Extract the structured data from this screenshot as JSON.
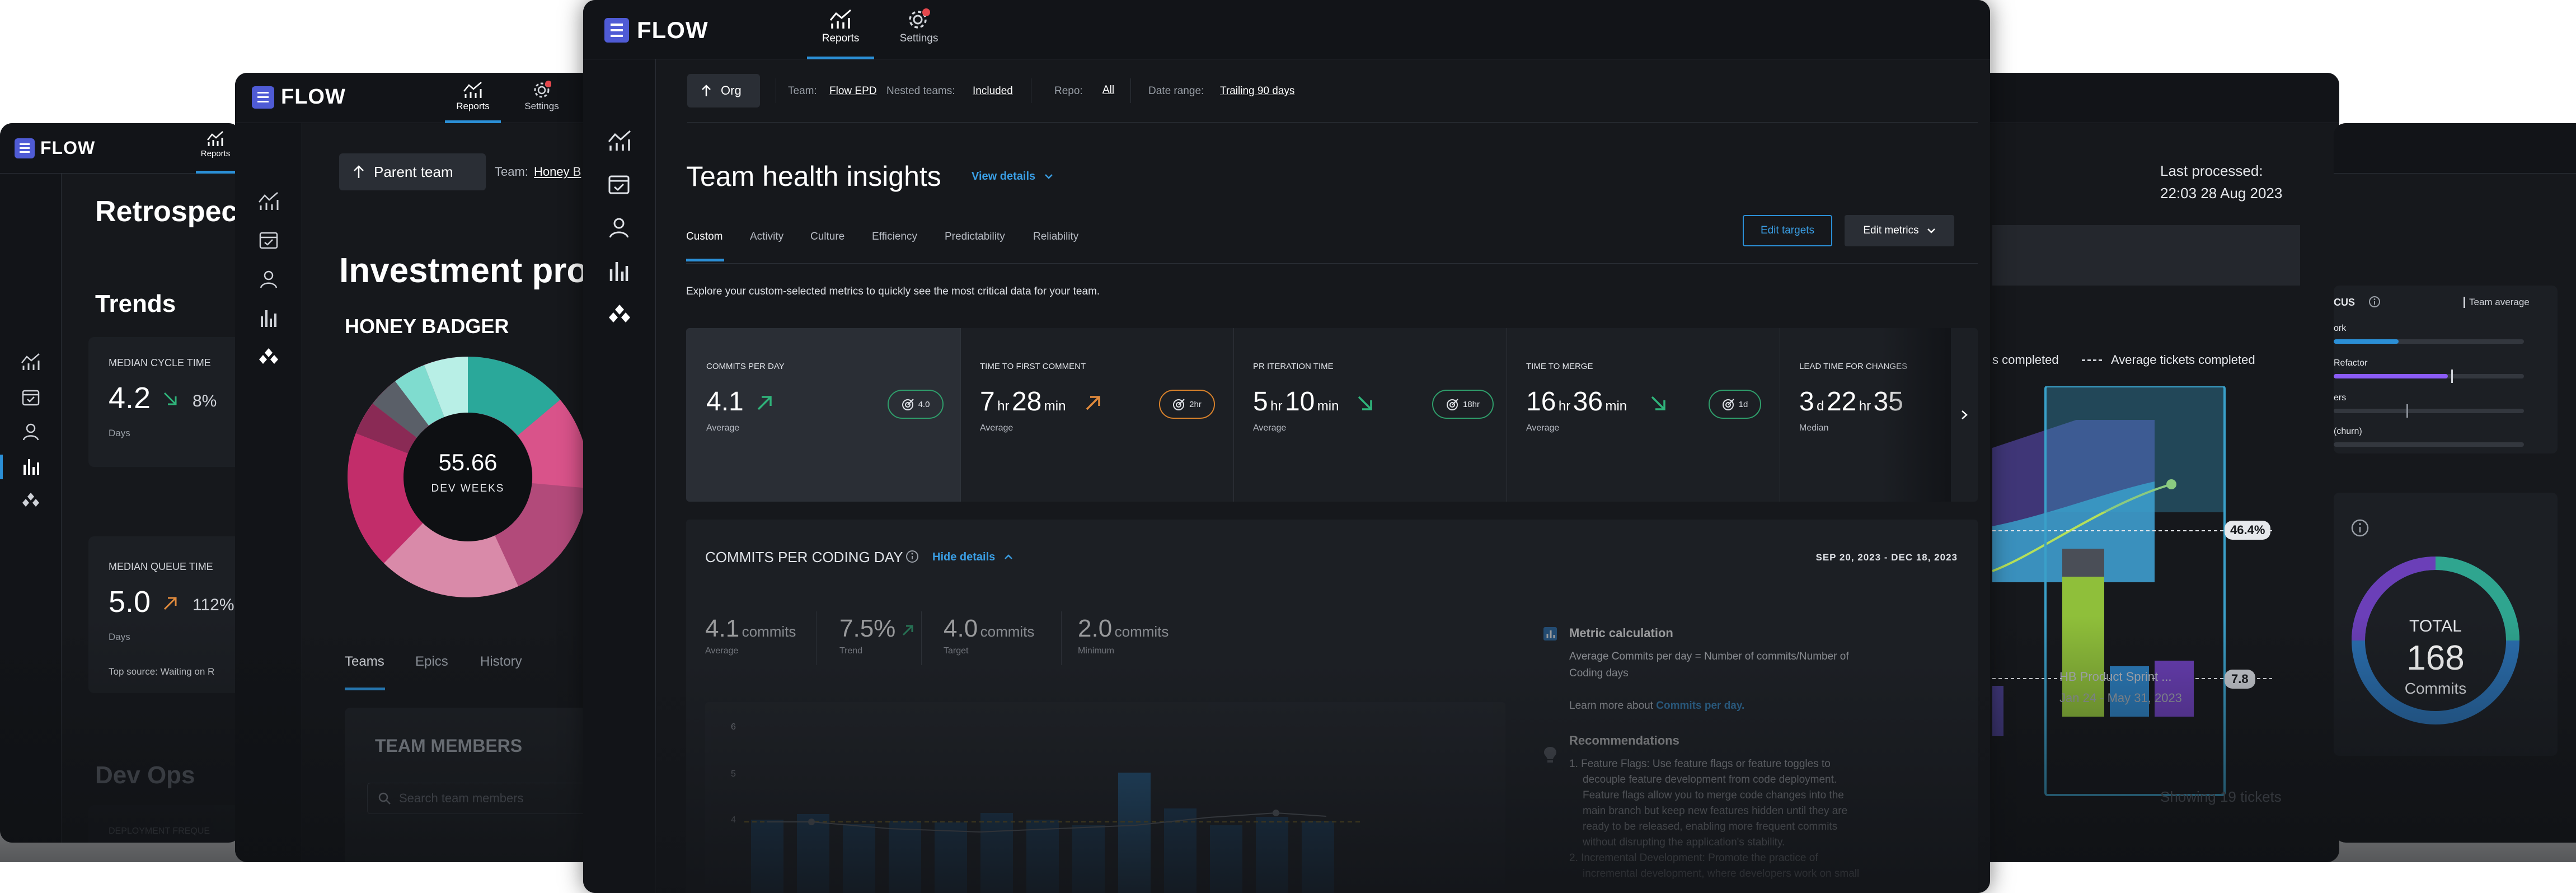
{
  "brand": {
    "name": "FLOW",
    "accent": "#4f5bd5",
    "link_color": "#3a9ee4",
    "red_dot": "#e5484d"
  },
  "nav": {
    "reports": "Reports",
    "settings": "Settings"
  },
  "sidebar_icons": [
    "reports-icon",
    "calendar-check-icon",
    "person-icon",
    "bar-chart-icon",
    "diamonds-icon"
  ],
  "retro": {
    "title": "Retrospec",
    "section_trends": "Trends",
    "cycle_label": "MEDIAN CYCLE TIME",
    "cycle_value": "4.2",
    "cycle_trend": "8%",
    "cycle_unit": "Days",
    "queue_label": "MEDIAN QUEUE TIME",
    "queue_value": "5.0",
    "queue_trend": "112%",
    "queue_unit": "Days",
    "top_source": "Top source: Waiting on R",
    "dev_ops": "Dev Ops",
    "deployment": "DEPLOYMENT FREQUE"
  },
  "investment": {
    "parent_team_btn": "Parent team",
    "team_label": "Team:",
    "team_value": "Honey B",
    "title": "Investment prof",
    "team_name": "HONEY BADGER",
    "donut_value": "55.66",
    "donut_unit": "DEV WEEKS",
    "tabs": [
      "Teams",
      "Epics",
      "History"
    ],
    "members_title": "TEAM MEMBERS",
    "search_placeholder": "Search team members"
  },
  "main": {
    "org_btn": "Org",
    "filters": {
      "team_label": "Team:",
      "team_value": "Flow EPD",
      "nested_label": "Nested teams:",
      "nested_value": "Included",
      "repo_label": "Repo:",
      "repo_value": "All",
      "date_label": "Date range:",
      "date_value": "Trailing 90 days"
    },
    "title": "Team health insights",
    "view_details": "View details",
    "tabs": [
      "Custom",
      "Activity",
      "Culture",
      "Efficiency",
      "Predictability",
      "Reliability"
    ],
    "edit_targets": "Edit targets",
    "edit_metrics": "Edit metrics",
    "description": "Explore your custom-selected metrics to quickly see the most critical data for your team.",
    "metrics": [
      {
        "label": "COMMITS PER DAY",
        "n1": "4.1",
        "u1": "",
        "n2": "",
        "u2": "",
        "sub": "Average",
        "badge": "4.0",
        "trend": "up-green",
        "badge_color": "#2f9e6b"
      },
      {
        "label": "TIME TO FIRST COMMENT",
        "n1": "7",
        "u1": "hr",
        "n2": "28",
        "u2": "min",
        "sub": "Average",
        "badge": "2hr",
        "trend": "up-orange",
        "badge_color": "#d9822b"
      },
      {
        "label": "PR ITERATION TIME",
        "n1": "5",
        "u1": "hr",
        "n2": "10",
        "u2": "min",
        "sub": "Average",
        "badge": "18hr",
        "trend": "down-green",
        "badge_color": "#2f9e6b"
      },
      {
        "label": "TIME TO MERGE",
        "n1": "16",
        "u1": "hr",
        "n2": "36",
        "u2": "min",
        "sub": "Average",
        "badge": "1d",
        "trend": "down-green",
        "badge_color": "#2f9e6b"
      },
      {
        "label": "LEAD TIME FOR CHANGES",
        "n1": "3",
        "u1": "d",
        "n2": "22",
        "u2": "hr",
        "n3": "35",
        "sub": "Median",
        "badge": "",
        "trend": "",
        "badge_color": ""
      }
    ],
    "detail": {
      "title": "COMMITS PER CODING DAY",
      "hide_details": "Hide details",
      "date_range": "SEP 20, 2023 - DEC 18, 2023",
      "stats": [
        {
          "value": "4.1",
          "unit": "commits",
          "label": "Average"
        },
        {
          "value": "7.5%",
          "unit": "",
          "label": "Trend"
        },
        {
          "value": "4.0",
          "unit": "commits",
          "label": "Target"
        },
        {
          "value": "2.0",
          "unit": "commits",
          "label": "Minimum"
        }
      ],
      "y_ticks": [
        "6",
        "5",
        "4"
      ],
      "metric_calc_title": "Metric calculation",
      "metric_calc_text_1": "Average Commits per day = Number of commits/Number of",
      "metric_calc_text_2": "Coding days",
      "learn_more": "Learn more about",
      "learn_more_link": "Commits per day.",
      "reco_title": "Recommendations",
      "reco_lines": [
        "1. Feature Flags: Use feature flags or feature toggles to",
        "decouple feature development from code deployment.",
        "Feature flags allow you to merge code changes into the",
        "main branch but keep new features hidden until they are",
        "ready to be released, enabling more frequent commits",
        "without disrupting the application's stability.",
        "2. Incremental Development: Promote the practice of",
        "incremental development, where developers work on small"
      ]
    }
  },
  "sprint": {
    "last_processed_label": "Last processed:",
    "last_processed_value": "22:03 28 Aug 2023",
    "legend_completed": "s completed",
    "legend_average": "Average tickets completed",
    "pct": "46.4%",
    "avg": "7.8",
    "sprint_name": "HB Product Sprint ...",
    "sprint_dates": "Jan 24 - May 31, 2023",
    "showing": "Showing 19 tickets"
  },
  "focus": {
    "title": "CUS",
    "team_average": "Team average",
    "rows": [
      {
        "label": "ork",
        "fill": 0.22,
        "color": "#2b8fd6"
      },
      {
        "label": "Refactor",
        "fill": 0.65,
        "color": "#8b5cf6"
      },
      {
        "label": "ers",
        "fill": 0.0,
        "color": "#8b5cf6"
      },
      {
        "label": "(churn)",
        "fill": 0.0,
        "color": "#8b5cf6"
      }
    ],
    "total_label": "TOTAL",
    "total_value": "168",
    "total_unit": "Commits"
  }
}
